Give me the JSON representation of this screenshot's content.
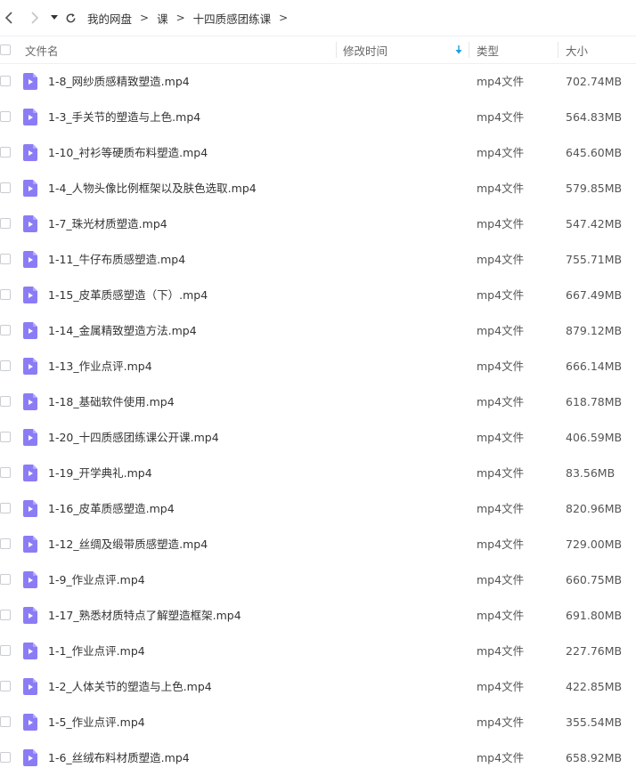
{
  "breadcrumb": [
    "我的网盘",
    "课",
    "十四质感团练课"
  ],
  "breadcrumb_separator": ">",
  "columns": {
    "name": "文件名",
    "modified": "修改时间",
    "type": "类型",
    "size": "大小"
  },
  "colors": {
    "accent": "#1a9fe0",
    "file_icon": "#8b7cf6"
  },
  "files": [
    {
      "name": "1-8_网纱质感精致塑造.mp4",
      "type": "mp4文件",
      "size": "702.74MB"
    },
    {
      "name": "1-3_手关节的塑造与上色.mp4",
      "type": "mp4文件",
      "size": "564.83MB"
    },
    {
      "name": "1-10_衬衫等硬质布料塑造.mp4",
      "type": "mp4文件",
      "size": "645.60MB"
    },
    {
      "name": "1-4_人物头像比例框架以及肤色选取.mp4",
      "type": "mp4文件",
      "size": "579.85MB"
    },
    {
      "name": "1-7_珠光材质塑造.mp4",
      "type": "mp4文件",
      "size": "547.42MB"
    },
    {
      "name": "1-11_牛仔布质感塑造.mp4",
      "type": "mp4文件",
      "size": "755.71MB"
    },
    {
      "name": "1-15_皮革质感塑造（下）.mp4",
      "type": "mp4文件",
      "size": "667.49MB"
    },
    {
      "name": "1-14_金属精致塑造方法.mp4",
      "type": "mp4文件",
      "size": "879.12MB"
    },
    {
      "name": "1-13_作业点评.mp4",
      "type": "mp4文件",
      "size": "666.14MB"
    },
    {
      "name": "1-18_基础软件使用.mp4",
      "type": "mp4文件",
      "size": "618.78MB"
    },
    {
      "name": "1-20_十四质感团练课公开课.mp4",
      "type": "mp4文件",
      "size": "406.59MB"
    },
    {
      "name": "1-19_开学典礼.mp4",
      "type": "mp4文件",
      "size": "83.56MB"
    },
    {
      "name": "1-16_皮革质感塑造.mp4",
      "type": "mp4文件",
      "size": "820.96MB"
    },
    {
      "name": "1-12_丝绸及缎带质感塑造.mp4",
      "type": "mp4文件",
      "size": "729.00MB"
    },
    {
      "name": "1-9_作业点评.mp4",
      "type": "mp4文件",
      "size": "660.75MB"
    },
    {
      "name": "1-17_熟悉材质特点了解塑造框架.mp4",
      "type": "mp4文件",
      "size": "691.80MB"
    },
    {
      "name": "1-1_作业点评.mp4",
      "type": "mp4文件",
      "size": "227.76MB"
    },
    {
      "name": "1-2_人体关节的塑造与上色.mp4",
      "type": "mp4文件",
      "size": "422.85MB"
    },
    {
      "name": "1-5_作业点评.mp4",
      "type": "mp4文件",
      "size": "355.54MB"
    },
    {
      "name": "1-6_丝绒布料材质塑造.mp4",
      "type": "mp4文件",
      "size": "658.92MB"
    }
  ]
}
